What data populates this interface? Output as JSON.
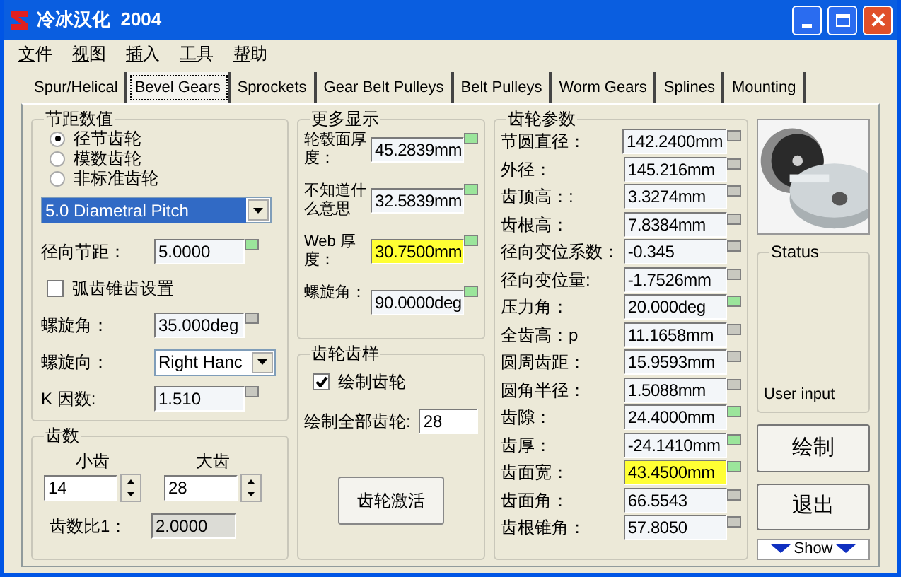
{
  "window": {
    "title": "冷冰汉化  2004"
  },
  "menu": [
    {
      "label": "文件"
    },
    {
      "label": "视图"
    },
    {
      "label": "插入"
    },
    {
      "label": "工具"
    },
    {
      "label": "帮助"
    }
  ],
  "tabs": [
    {
      "label": "Spur/Helical",
      "selected": false
    },
    {
      "label": "Bevel Gears",
      "selected": true
    },
    {
      "label": "Sprockets",
      "selected": false
    },
    {
      "label": "Gear Belt Pulleys",
      "selected": false
    },
    {
      "label": "Belt Pulleys",
      "selected": false
    },
    {
      "label": "Worm Gears",
      "selected": false
    },
    {
      "label": "Splines",
      "selected": false
    },
    {
      "label": "Mounting",
      "selected": false
    }
  ],
  "pitch_group": {
    "title": "节距数值",
    "options": [
      {
        "label": "径节齿轮",
        "selected": true
      },
      {
        "label": "模数齿轮",
        "selected": false
      },
      {
        "label": "非标准齿轮",
        "selected": false
      }
    ],
    "pitch_select": "5.0 Diametral Pitch",
    "rows": [
      {
        "kind": "field",
        "label": "径向节距：",
        "value": "5.0000",
        "active": true
      },
      {
        "kind": "checkbox",
        "label": "弧齿锥齿设置",
        "checked": false
      },
      {
        "kind": "field",
        "label": "螺旋角：",
        "value": "35.000deg",
        "active": false
      },
      {
        "kind": "select",
        "label": "螺旋向：",
        "value": "Right Hanc"
      },
      {
        "kind": "field",
        "label": "K 因数:",
        "value": "1.510",
        "active": false
      }
    ]
  },
  "teeth_group": {
    "title": "齿数",
    "pinion": {
      "label": "小齿",
      "value": "14"
    },
    "gear": {
      "label": "大齿",
      "value": "28"
    },
    "ratio": {
      "label": "齿数比1：",
      "value": "2.0000"
    }
  },
  "more_display": {
    "title": "更多显示",
    "rows": [
      {
        "label": "轮毂面厚度：",
        "value": "45.2839mm",
        "highlighted": false,
        "active": true
      },
      {
        "label": "不知道什么意思",
        "value": "32.5839mm",
        "highlighted": false,
        "active": true
      },
      {
        "label": "Web 厚度：",
        "value": "30.7500mm",
        "highlighted": true,
        "active": true
      },
      {
        "label": "螺旋角：",
        "value": "90.0000deg",
        "highlighted": false,
        "active": true
      }
    ]
  },
  "gear_sample": {
    "title": "齿轮齿样",
    "draw_gear": {
      "label": "绘制齿轮",
      "checked": true
    },
    "draw_all": {
      "label": "绘制全部齿轮:",
      "value": "28"
    },
    "button": "齿轮激活"
  },
  "params": {
    "title": "齿轮参数",
    "rows": [
      {
        "label": "节圆直径：",
        "value": "142.2400mm",
        "highlighted": false,
        "active": false
      },
      {
        "label": "外径：",
        "value": "145.216mm",
        "highlighted": false,
        "active": false
      },
      {
        "label": "齿顶高：:",
        "value": "3.3274mm",
        "highlighted": false,
        "active": false
      },
      {
        "label": "齿根高：",
        "value": "7.8384mm",
        "highlighted": false,
        "active": false
      },
      {
        "label": "径向变位系数：",
        "value": "-0.345",
        "highlighted": false,
        "active": false
      },
      {
        "label": "径向变位量:",
        "value": "-1.7526mm",
        "highlighted": false,
        "active": false
      },
      {
        "label": "压力角：",
        "value": "20.000deg",
        "highlighted": false,
        "active": true
      },
      {
        "label": "全齿高：p",
        "value": "11.1658mm",
        "highlighted": false,
        "active": false
      },
      {
        "label": "圆周齿距：",
        "value": "15.9593mm",
        "highlighted": false,
        "active": false
      },
      {
        "label": "圆角半径：",
        "value": "1.5088mm",
        "highlighted": false,
        "active": false
      },
      {
        "label": "齿隙：",
        "value": "24.4000mm",
        "highlighted": false,
        "active": true
      },
      {
        "label": "齿厚：",
        "value": "-24.1410mm",
        "highlighted": false,
        "active": true
      },
      {
        "label": "齿面宽：",
        "value": "43.4500mm",
        "highlighted": true,
        "active": true
      },
      {
        "label": "齿面角：",
        "value": "66.5543",
        "highlighted": false,
        "active": false
      },
      {
        "label": "齿根锥角：",
        "value": "57.8050",
        "highlighted": false,
        "active": false
      }
    ]
  },
  "status": {
    "title": "Status",
    "text": "User input"
  },
  "buttons": [
    {
      "label": "绘制"
    },
    {
      "label": "退出"
    }
  ],
  "show_button": "Show"
}
